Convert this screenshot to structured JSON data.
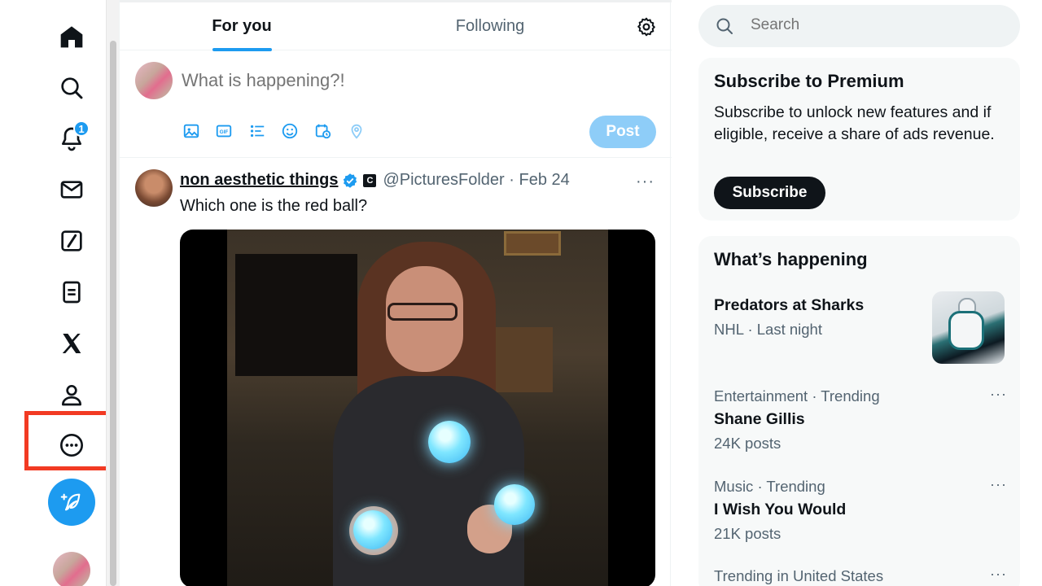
{
  "nav": {
    "notification_count": "1",
    "items": [
      "home-icon",
      "search-icon",
      "bell-icon",
      "mail-icon",
      "grok-icon",
      "lists-icon",
      "x-logo-icon",
      "profile-icon",
      "more-icon"
    ]
  },
  "tabs": {
    "for_you": "For you",
    "following": "Following"
  },
  "composer": {
    "placeholder": "What is happening?!",
    "post_label": "Post"
  },
  "tweet": {
    "author": "non aesthetic things",
    "affiliate_badge": "C",
    "handle": "@PicturesFolder · Feb 24",
    "more": "···",
    "text": "Which one is the red ball?"
  },
  "search": {
    "placeholder": "Search"
  },
  "premium": {
    "title": "Subscribe to Premium",
    "body": "Subscribe to unlock new features and if eligible, receive a share of ads revenue.",
    "button": "Subscribe"
  },
  "happening": {
    "title": "What’s happening",
    "trends": [
      {
        "meta": "",
        "name": "Predators at Sharks",
        "sub": "NHL · Last night"
      },
      {
        "meta": "Entertainment · Trending",
        "name": "Shane Gillis",
        "sub": "24K posts",
        "more": "···"
      },
      {
        "meta": "Music · Trending",
        "name": "I Wish You Would",
        "sub": "21K posts",
        "more": "···"
      },
      {
        "meta": "Trending in United States",
        "name": "",
        "sub": "",
        "more": "···"
      }
    ]
  },
  "colors": {
    "accent": "#1d9bf0",
    "highlight": "#f23a23",
    "text": "#0f1419",
    "muted": "#536471"
  }
}
